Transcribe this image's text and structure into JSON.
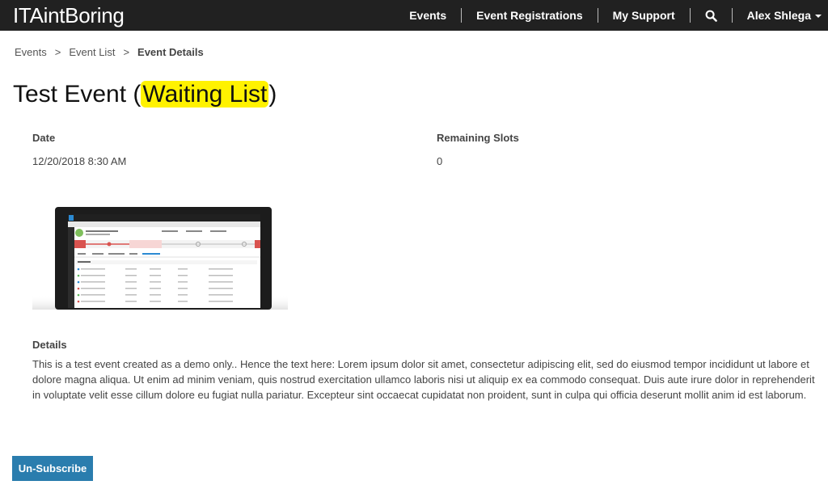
{
  "nav": {
    "brand": "ITAintBoring",
    "items": [
      {
        "label": "Events"
      },
      {
        "label": "Event Registrations"
      },
      {
        "label": "My Support"
      }
    ],
    "user": "Alex Shlega"
  },
  "breadcrumb": {
    "items": [
      "Events",
      "Event List"
    ],
    "separator": ">",
    "current": "Event Details"
  },
  "title": {
    "prefix": "Test Event (",
    "highlight": "Waiting List",
    "suffix": ")"
  },
  "fields": {
    "date_label": "Date",
    "date_value": "12/20/2018 8:30 AM",
    "slots_label": "Remaining Slots",
    "slots_value": "0"
  },
  "details": {
    "label": "Details",
    "text": "This is a test event created as a demo only.. Hence the text here: Lorem ipsum dolor sit amet, consectetur adipiscing elit, sed do eiusmod tempor incididunt ut labore et dolore magna aliqua. Ut enim ad minim veniam, quis nostrud exercitation ullamco laboris nisi ut aliquip ex ea commodo consequat. Duis aute irure dolor in reprehenderit in voluptate velit esse cillum dolore eu fugiat nulla pariatur. Excepteur sint occaecat cupidatat non proident, sunt in culpa qui officia deserunt mollit anim id est laborum."
  },
  "button": {
    "label": "Un-Subscribe"
  },
  "colors": {
    "topbar": "#212121",
    "highlight": "#fff200",
    "button": "#2a7dae"
  },
  "icons": {
    "search": "search-icon",
    "user_menu": "caret-down-icon"
  }
}
